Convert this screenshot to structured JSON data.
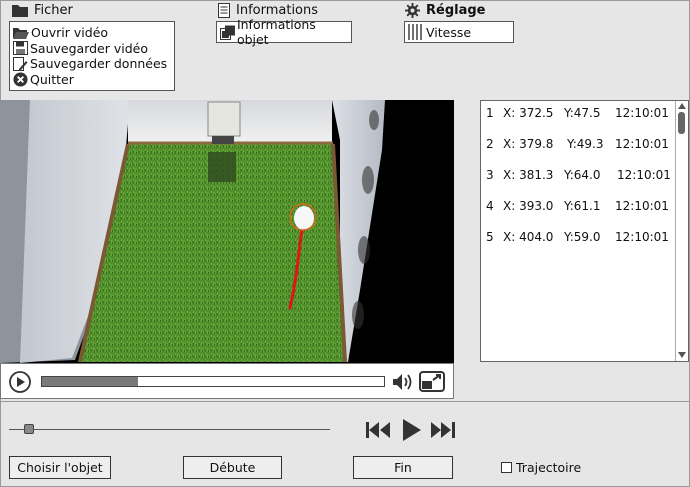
{
  "menubar": {
    "file_label": "Ficher",
    "file_icon": "folder-icon",
    "info_label": "Informations",
    "info_icon": "document-icon",
    "settings_label": "Réglage",
    "settings_icon": "gear-icon"
  },
  "file_menu": {
    "items": [
      {
        "label": "Ouvrir vidéo",
        "icon": "open-folder-icon"
      },
      {
        "label": "Sauvegarder vidéo",
        "icon": "floppy-disk-icon"
      },
      {
        "label": "Sauvegarder données",
        "icon": "edit-document-icon"
      },
      {
        "label": "Quitter",
        "icon": "close-circle-icon"
      }
    ]
  },
  "info_menu": {
    "label": "Informations objet",
    "icon": "copy-icon"
  },
  "settings_menu": {
    "label": "Vitesse",
    "icon": "bars-icon"
  },
  "player": {
    "progress": 0.28,
    "icons": {
      "play": "play-icon",
      "volume": "volume-icon",
      "fullscreen": "fullscreen-icon"
    }
  },
  "coordinates": {
    "rows": [
      {
        "index": "1",
        "x": "X: 372.5",
        "y": "Y:47.5",
        "time": "12:10:01"
      },
      {
        "index": "2",
        "x": "X: 379.8",
        "y": "Y:49.3",
        "time": "12:10:01"
      },
      {
        "index": "3",
        "x": "X: 381.3",
        "y": "Y:64.0",
        "time": "12:10:01"
      },
      {
        "index": "4",
        "x": "X: 393.0",
        "y": "Y:61.1",
        "time": "12:10:01"
      },
      {
        "index": "5",
        "x": "X: 404.0",
        "y": "Y:59.0",
        "time": "12:10:01"
      }
    ]
  },
  "timeline": {
    "position": 0.05
  },
  "transport": {
    "icons": [
      "skip-back-icon",
      "play-icon",
      "skip-forward-icon"
    ]
  },
  "buttons": {
    "choose": "Choisir l'objet",
    "start": "Débute",
    "end": "Fin"
  },
  "trajectory": {
    "label": "Trajectoire",
    "checked": false
  },
  "colors": {
    "track": "#e01515",
    "target_ring": "#d2691e"
  }
}
